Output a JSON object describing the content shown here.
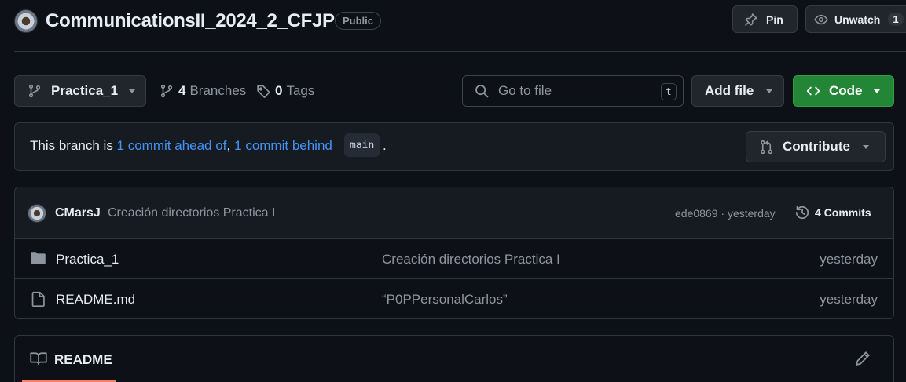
{
  "repo": {
    "name": "CommunicationsII_2024_2_CFJP",
    "visibility": "Public",
    "pin_label": "Pin",
    "watch_label": "Unwatch",
    "watch_count": "1"
  },
  "toolbar": {
    "branch_name": "Practica_1",
    "branches_count": "4",
    "branches_label": "Branches",
    "tags_count": "0",
    "tags_label": "Tags",
    "go_to_file_placeholder": "Go to file",
    "go_to_file_shortcut": "t",
    "add_file_label": "Add file",
    "code_label": "Code"
  },
  "branch_status": {
    "prefix": "This branch is ",
    "ahead_text": "1 commit ahead of",
    "comma": ",",
    "behind_text": "1 commit behind",
    "base_branch": "main",
    "suffix": ".",
    "contribute_label": "Contribute"
  },
  "latest_commit": {
    "author": "CMarsJ",
    "message": "Creación directorios Practica I",
    "sha": "ede0869",
    "separator": " · ",
    "time": "yesterday",
    "commits_count_label": "4 Commits"
  },
  "files": [
    {
      "name": "Practica_1",
      "type": "folder",
      "message": "Creación directorios Practica I",
      "time": "yesterday"
    },
    {
      "name": "README.md",
      "type": "file",
      "message": "“P0PPersonalCarlos”",
      "time": "yesterday"
    }
  ],
  "readme": {
    "title": "README"
  },
  "colors": {
    "background": "#0d1117",
    "accent_link": "#4493f8",
    "code_button": "#238636",
    "border": "#30363d"
  },
  "icons": [
    "repo-avatar",
    "pin-icon",
    "eye-icon",
    "git-branch-icon",
    "tag-icon",
    "search-icon",
    "code-icon",
    "git-pull-request-icon",
    "history-icon",
    "folder-icon",
    "file-icon",
    "book-icon",
    "pencil-icon"
  ]
}
